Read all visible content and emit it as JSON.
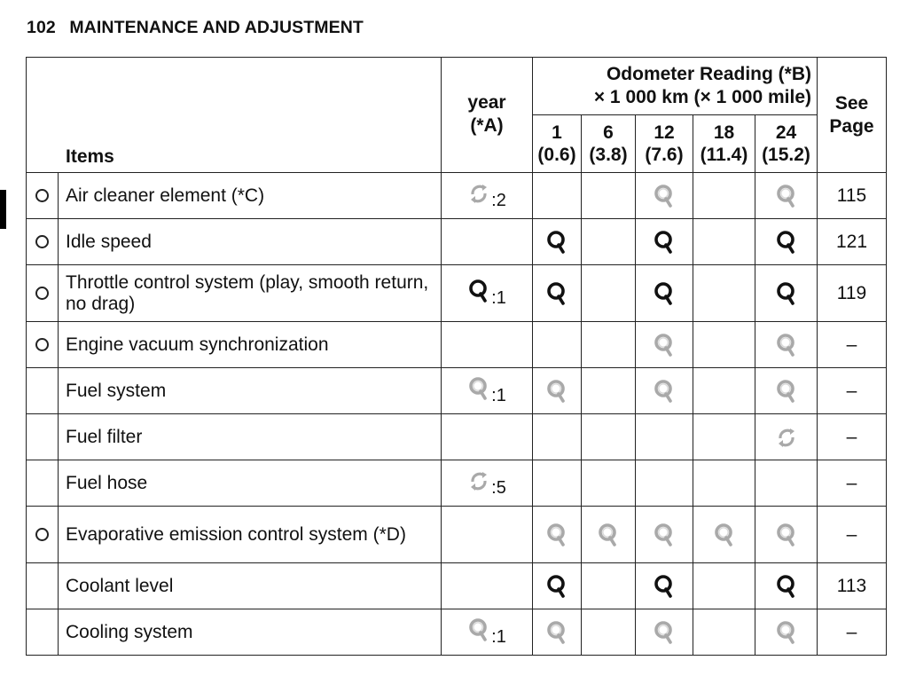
{
  "page": {
    "number": "102",
    "section_title": "MAINTENANCE AND ADJUSTMENT"
  },
  "icons": {
    "inspect": "magnifier-icon (inspect)",
    "replace": "circular-arrows-icon (replace)",
    "emission_marker": "circle-icon (emission-related item)"
  },
  "colors": {
    "icon_dark": "#111111",
    "icon_light": "#a9a9a9",
    "grid": "#222222"
  },
  "table": {
    "headers": {
      "items": "Items",
      "year_line1": "year",
      "year_line2": "(*A)",
      "odometer_line1": "Odometer Reading (*B)",
      "odometer_line2": "× 1 000 km (× 1 000 mile)",
      "see_page_line1": "See",
      "see_page_line2": "Page"
    },
    "odometer_columns": [
      {
        "km": "1",
        "mile": "(0.6)"
      },
      {
        "km": "6",
        "mile": "(3.8)"
      },
      {
        "km": "12",
        "mile": "(7.6)"
      },
      {
        "km": "18",
        "mile": "(11.4)"
      },
      {
        "km": "24",
        "mile": "(15.2)"
      }
    ],
    "rows": [
      {
        "emission": true,
        "item": "Air cleaner element (*C)",
        "year": {
          "icon": "replace",
          "tone": "light",
          "suffix": ":2"
        },
        "odo": [
          null,
          null,
          {
            "icon": "inspect",
            "tone": "light"
          },
          null,
          {
            "icon": "inspect",
            "tone": "light"
          }
        ],
        "page": "115"
      },
      {
        "emission": true,
        "item": "Idle speed",
        "year": null,
        "odo": [
          {
            "icon": "inspect",
            "tone": "dark"
          },
          null,
          {
            "icon": "inspect",
            "tone": "dark"
          },
          null,
          {
            "icon": "inspect",
            "tone": "dark"
          }
        ],
        "page": "121"
      },
      {
        "emission": true,
        "item": "Throttle control system (play, smooth return, no drag)",
        "year": {
          "icon": "inspect",
          "tone": "dark",
          "suffix": ":1"
        },
        "odo": [
          {
            "icon": "inspect",
            "tone": "dark"
          },
          null,
          {
            "icon": "inspect",
            "tone": "dark"
          },
          null,
          {
            "icon": "inspect",
            "tone": "dark"
          }
        ],
        "page": "119"
      },
      {
        "emission": true,
        "item": "Engine vacuum synchronization",
        "year": null,
        "odo": [
          null,
          null,
          {
            "icon": "inspect",
            "tone": "light"
          },
          null,
          {
            "icon": "inspect",
            "tone": "light"
          }
        ],
        "page": "–"
      },
      {
        "emission": false,
        "item": "Fuel system",
        "year": {
          "icon": "inspect",
          "tone": "light",
          "suffix": ":1"
        },
        "odo": [
          {
            "icon": "inspect",
            "tone": "light"
          },
          null,
          {
            "icon": "inspect",
            "tone": "light"
          },
          null,
          {
            "icon": "inspect",
            "tone": "light"
          }
        ],
        "page": "–"
      },
      {
        "emission": false,
        "item": "Fuel filter",
        "year": null,
        "odo": [
          null,
          null,
          null,
          null,
          {
            "icon": "replace",
            "tone": "light"
          }
        ],
        "page": "–"
      },
      {
        "emission": false,
        "item": "Fuel hose",
        "year": {
          "icon": "replace",
          "tone": "light",
          "suffix": ":5"
        },
        "odo": [
          null,
          null,
          null,
          null,
          null
        ],
        "page": "–"
      },
      {
        "emission": true,
        "item": "Evaporative emission control system (*D)",
        "year": null,
        "odo": [
          {
            "icon": "inspect",
            "tone": "light"
          },
          {
            "icon": "inspect",
            "tone": "light"
          },
          {
            "icon": "inspect",
            "tone": "light"
          },
          {
            "icon": "inspect",
            "tone": "light"
          },
          {
            "icon": "inspect",
            "tone": "light"
          }
        ],
        "page": "–"
      },
      {
        "emission": false,
        "item": "Coolant level",
        "year": null,
        "odo": [
          {
            "icon": "inspect",
            "tone": "dark"
          },
          null,
          {
            "icon": "inspect",
            "tone": "dark"
          },
          null,
          {
            "icon": "inspect",
            "tone": "dark"
          }
        ],
        "page": "113"
      },
      {
        "emission": false,
        "item": "Cooling system",
        "year": {
          "icon": "inspect",
          "tone": "light",
          "suffix": ":1"
        },
        "odo": [
          {
            "icon": "inspect",
            "tone": "light"
          },
          null,
          {
            "icon": "inspect",
            "tone": "light"
          },
          null,
          {
            "icon": "inspect",
            "tone": "light"
          }
        ],
        "page": "–"
      }
    ]
  }
}
